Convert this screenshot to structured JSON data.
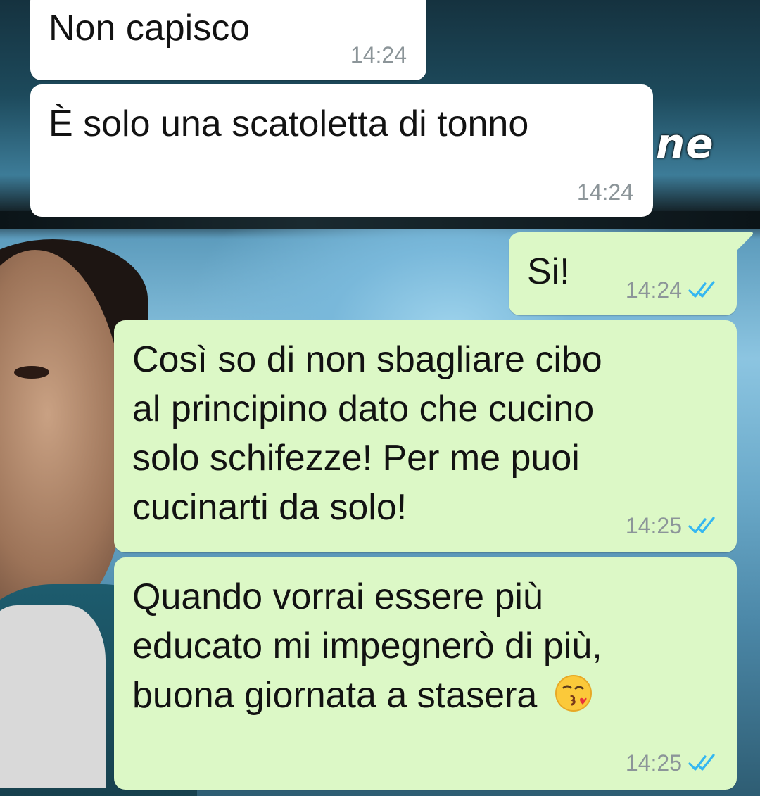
{
  "chat": {
    "messages": [
      {
        "direction": "incoming",
        "lines": [
          "Non capisco"
        ],
        "time": "14:24"
      },
      {
        "direction": "incoming",
        "lines": [
          "È solo una scatoletta di tonno"
        ],
        "time": "14:24"
      },
      {
        "direction": "outgoing",
        "lines": [
          "Si!"
        ],
        "time": "14:24",
        "status_icon": "double-check-read-icon"
      },
      {
        "direction": "outgoing",
        "lines": [
          "Così so di non sbagliare cibo",
          "al principino dato che cucino",
          "solo schifezze! Per me puoi",
          "cucinarti da solo!"
        ],
        "time": "14:25",
        "status_icon": "double-check-read-icon"
      },
      {
        "direction": "outgoing",
        "lines": [
          "Quando vorrai essere più",
          "educato mi impegnerò di più,",
          "buona giornata a stasera"
        ],
        "emoji": "face-blowing-a-kiss-icon",
        "time": "14:25",
        "status_icon": "double-check-read-icon"
      }
    ]
  },
  "wallpaper": {
    "caption_fragment": "ne"
  },
  "colors": {
    "incoming_bubble": "#ffffff",
    "outgoing_bubble": "#dcf8c6",
    "timestamp": "#8c9599",
    "read_check": "#34b7f1",
    "message_text": "#121212"
  }
}
